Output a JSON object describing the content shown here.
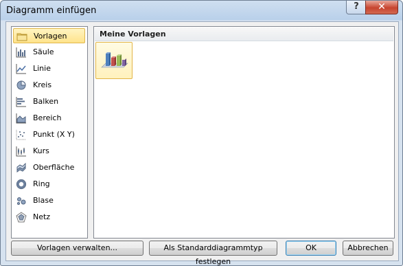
{
  "window": {
    "title": "Diagramm einfügen",
    "help_label": "?",
    "close_label": "✕"
  },
  "categories": [
    {
      "label": "Vorlagen",
      "icon": "folder-icon",
      "selected": true
    },
    {
      "label": "Säule",
      "icon": "column-chart-icon"
    },
    {
      "label": "Linie",
      "icon": "line-chart-icon"
    },
    {
      "label": "Kreis",
      "icon": "pie-chart-icon"
    },
    {
      "label": "Balken",
      "icon": "bar-chart-icon"
    },
    {
      "label": "Bereich",
      "icon": "area-chart-icon"
    },
    {
      "label": "Punkt (X Y)",
      "icon": "scatter-chart-icon"
    },
    {
      "label": "Kurs",
      "icon": "stock-chart-icon"
    },
    {
      "label": "Oberfläche",
      "icon": "surface-chart-icon"
    },
    {
      "label": "Ring",
      "icon": "doughnut-chart-icon"
    },
    {
      "label": "Blase",
      "icon": "bubble-chart-icon"
    },
    {
      "label": "Netz",
      "icon": "radar-chart-icon"
    }
  ],
  "templates": {
    "header": "Meine Vorlagen",
    "items": [
      {
        "icon": "3d-column-chart-template-icon"
      }
    ]
  },
  "buttons": {
    "manage": "Vorlagen verwalten...",
    "set_default": "Als Standarddiagrammtyp festlegen",
    "ok": "OK",
    "cancel": "Abbrechen"
  },
  "colors": {
    "selection_fill": "#ffe38b",
    "selection_border": "#e0b64a",
    "titlebar": "#b9d0ea",
    "close_button": "#c7442f"
  }
}
